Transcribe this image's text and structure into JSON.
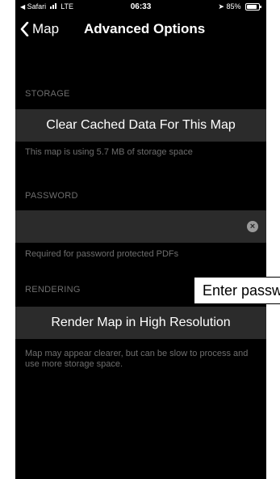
{
  "status_bar": {
    "carrier": "Safari",
    "network": "LTE",
    "time": "06:33",
    "battery": "85%",
    "battery_level": 0.85
  },
  "nav": {
    "back_label": "Map",
    "title": "Advanced Options"
  },
  "sections": {
    "storage": {
      "header": "STORAGE",
      "button_label": "Clear Cached Data For This Map",
      "footer": "This map is using 5.7 MB of storage space"
    },
    "password": {
      "header": "PASSWORD",
      "input_value": "",
      "footer": "Required for password protected PDFs"
    },
    "rendering": {
      "header": "RENDERING",
      "button_label": "Render Map in High Resolution",
      "footer": "Map may appear clearer, but can be slow to process and use more storage space."
    }
  },
  "tooltip": {
    "text": "Enter password"
  },
  "colors": {
    "background": "#000000",
    "cell": "#2b2b2b",
    "secondary_text": "#6e6e6e"
  }
}
